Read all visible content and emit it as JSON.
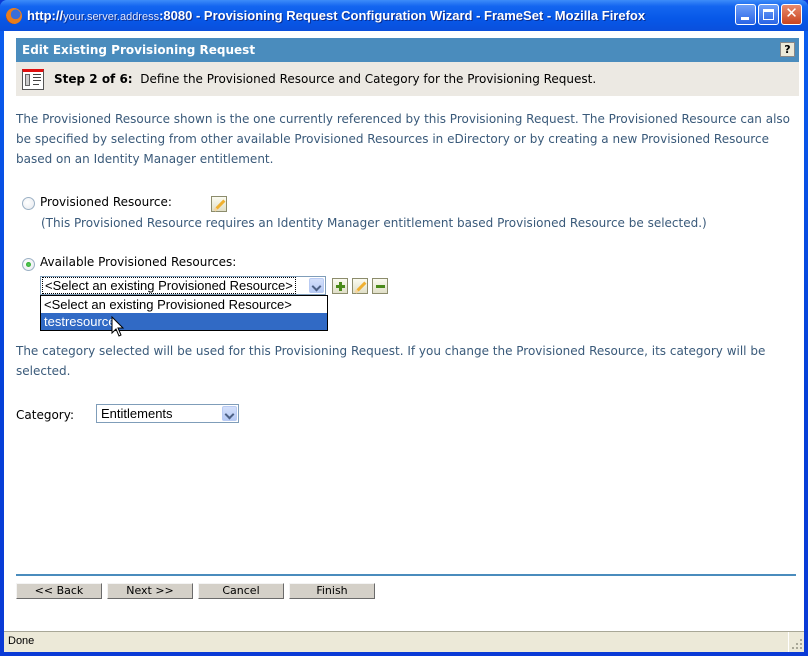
{
  "window": {
    "title_prefix": "http://",
    "title_server": "your.server.address",
    "title_suffix": ":8080 - Provisioning Request Configuration Wizard - FrameSet - Mozilla Firefox",
    "minimize_icon": "minimize-icon",
    "maximize_icon": "maximize-icon",
    "close_icon": "close-icon"
  },
  "header": {
    "title": "Edit Existing Provisioning Request",
    "help_label": "?"
  },
  "step": {
    "label": "Step 2 of 6:",
    "description": "Define the Provisioned Resource and Category for the Provisioning Request."
  },
  "intro_text": "The Provisioned Resource shown is the one currently referenced by this Provisioning Request.  The Provisioned Resource can also be specified by selecting from other available Provisioned Resources in eDirectory or by creating a new Provisioned Resource based on an Identity Manager entitlement.",
  "provisioned_resource": {
    "label": "Provisioned Resource:",
    "selected": false,
    "note": "(This Provisioned Resource requires an Identity Manager entitlement based Provisioned Resource be selected.)"
  },
  "available_resources": {
    "label": "Available Provisioned Resources:",
    "selected": true,
    "select_value": "<Select an existing Provisioned Resource>",
    "options": [
      {
        "label": "<Select an existing Provisioned Resource>",
        "highlighted": false
      },
      {
        "label": "testresource",
        "highlighted": true
      }
    ]
  },
  "category_text": "The category selected will be used for this Provisioning Request.  If you change the Provisioned Resource, its category will be selected.",
  "category": {
    "label": "Category:",
    "value": "Entitlements"
  },
  "buttons": {
    "back": "<< Back",
    "next": "Next >>",
    "cancel": "Cancel",
    "finish": "Finish"
  },
  "status_bar": {
    "text": "Done"
  },
  "colors": {
    "header_bg": "#4a8cbd",
    "step_bg": "#ece9e3",
    "text_blue": "#3a5a7a",
    "highlight": "#316ac5"
  }
}
